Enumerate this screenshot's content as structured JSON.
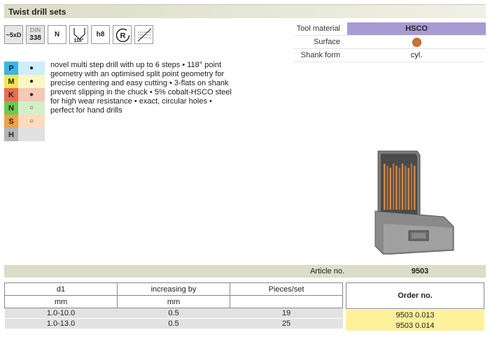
{
  "title": "Twist drill sets",
  "icons": {
    "length": "~5xD",
    "din_top": "DIN",
    "din_num": "338",
    "type": "N",
    "angle": "118°",
    "tolerance": "h8"
  },
  "spec": {
    "tool_material_label": "Tool material",
    "tool_material_value": "HSCO",
    "surface_label": "Surface",
    "shank_label": "Shank form",
    "shank_value": "cyl.",
    "material_color": "#a99ad4",
    "surface_color": "#c87433"
  },
  "materials": [
    {
      "letter": "P",
      "mark": "●",
      "color": "#3cb4e6",
      "bg": "#cdeefa"
    },
    {
      "letter": "M",
      "mark": "●",
      "color": "#f0e650",
      "bg": "#fbf7c4"
    },
    {
      "letter": "K",
      "mark": "●",
      "color": "#e66e50",
      "bg": "#f5c8b8"
    },
    {
      "letter": "N",
      "mark": "○",
      "color": "#6ec850",
      "bg": "#d4efc8"
    },
    {
      "letter": "S",
      "mark": "○",
      "color": "#f0a046",
      "bg": "#fbdcbc"
    },
    {
      "letter": "H",
      "mark": "",
      "color": "#b4b4b4",
      "bg": "#e0e0e0"
    }
  ],
  "description": "novel multi step drill with up to 6 steps • 118° point geometry with an optimised split point geometry for precise centering and easy cutting • 3-flats on shank prevent slipping in the chuck • 5% cobalt-HSCO steel for high wear resistance • exact, circular holes • perfect for hand drills",
  "article": {
    "label": "Article no.",
    "number": "9503"
  },
  "table": {
    "headers": [
      "d1",
      "increasing by",
      "Pieces/set"
    ],
    "units": [
      "mm",
      "mm",
      ""
    ],
    "order_header": "Order no.",
    "rows": [
      {
        "d1": "1.0-10.0",
        "step": "0.5",
        "pieces": "19",
        "order": "9503 0.013"
      },
      {
        "d1": "1.0-13.0",
        "step": "0.5",
        "pieces": "25",
        "order": "9503 0.014"
      }
    ]
  }
}
